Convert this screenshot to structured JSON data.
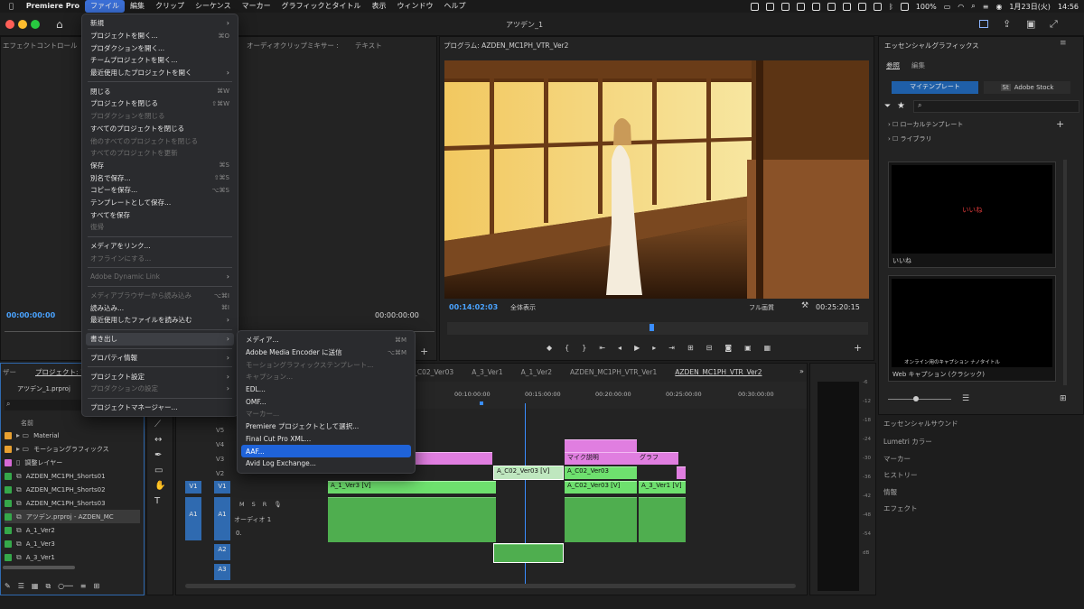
{
  "menubar": {
    "items": [
      "Premiere Pro",
      "ファイル",
      "編集",
      "クリップ",
      "シーケンス",
      "マーカー",
      "グラフィックとタイトル",
      "表示",
      "ウィンドウ",
      "ヘルプ"
    ],
    "battery": "100%",
    "wifi": "",
    "date": "1月23日(火)",
    "time": "14:56"
  },
  "window": {
    "title": "アツデン_1"
  },
  "file_menu": [
    {
      "label": "新規",
      "shortcut": "",
      "submenu": true,
      "disabled": false
    },
    {
      "label": "プロジェクトを開く...",
      "shortcut": "⌘O",
      "submenu": false,
      "disabled": false
    },
    {
      "label": "プロダクションを開く...",
      "shortcut": "",
      "submenu": false,
      "disabled": false
    },
    {
      "label": "チームプロジェクトを開く...",
      "shortcut": "",
      "submenu": false,
      "disabled": false
    },
    {
      "label": "最近使用したプロジェクトを開く",
      "shortcut": "",
      "submenu": true,
      "disabled": false
    },
    {
      "sep": true
    },
    {
      "label": "閉じる",
      "shortcut": "⌘W",
      "submenu": false,
      "disabled": false
    },
    {
      "label": "プロジェクトを閉じる",
      "shortcut": "⇧⌘W",
      "submenu": false,
      "disabled": false
    },
    {
      "label": "プロダクションを閉じる",
      "shortcut": "",
      "submenu": false,
      "disabled": true
    },
    {
      "label": "すべてのプロジェクトを閉じる",
      "shortcut": "",
      "submenu": false,
      "disabled": false
    },
    {
      "label": "他のすべてのプロジェクトを閉じる",
      "shortcut": "",
      "submenu": false,
      "disabled": true
    },
    {
      "label": "すべてのプロジェクトを更新",
      "shortcut": "",
      "submenu": false,
      "disabled": true
    },
    {
      "label": "保存",
      "shortcut": "⌘S",
      "submenu": false,
      "disabled": false
    },
    {
      "label": "別名で保存...",
      "shortcut": "⇧⌘S",
      "submenu": false,
      "disabled": false
    },
    {
      "label": "コピーを保存...",
      "shortcut": "⌥⌘S",
      "submenu": false,
      "disabled": false
    },
    {
      "label": "テンプレートとして保存...",
      "shortcut": "",
      "submenu": false,
      "disabled": false
    },
    {
      "label": "すべてを保存",
      "shortcut": "",
      "submenu": false,
      "disabled": false
    },
    {
      "label": "復帰",
      "shortcut": "",
      "submenu": false,
      "disabled": true
    },
    {
      "sep": true
    },
    {
      "label": "メディアをリンク...",
      "shortcut": "",
      "submenu": false,
      "disabled": false
    },
    {
      "label": "オフラインにする...",
      "shortcut": "",
      "submenu": false,
      "disabled": true
    },
    {
      "sep": true
    },
    {
      "label": "Adobe Dynamic Link",
      "shortcut": "",
      "submenu": true,
      "disabled": true
    },
    {
      "sep": true
    },
    {
      "label": "メディアブラウザーから読み込み",
      "shortcut": "⌥⌘I",
      "submenu": false,
      "disabled": true
    },
    {
      "label": "読み込み...",
      "shortcut": "⌘I",
      "submenu": false,
      "disabled": false
    },
    {
      "label": "最近使用したファイルを読み込む",
      "shortcut": "",
      "submenu": true,
      "disabled": false
    },
    {
      "sep": true
    },
    {
      "label": "書き出し",
      "shortcut": "",
      "submenu": true,
      "disabled": false,
      "highlight": true
    },
    {
      "sep": true
    },
    {
      "label": "プロパティ情報",
      "shortcut": "",
      "submenu": true,
      "disabled": false
    },
    {
      "sep": true
    },
    {
      "label": "プロジェクト設定",
      "shortcut": "",
      "submenu": true,
      "disabled": false
    },
    {
      "label": "プロダクションの設定",
      "shortcut": "",
      "submenu": true,
      "disabled": true
    },
    {
      "sep": true
    },
    {
      "label": "プロジェクトマネージャー...",
      "shortcut": "",
      "submenu": false,
      "disabled": false
    }
  ],
  "export_menu": [
    {
      "label": "メディア...",
      "shortcut": "⌘M",
      "disabled": false
    },
    {
      "label": "Adobe Media Encoder に送信",
      "shortcut": "⌥⌘M",
      "disabled": false
    },
    {
      "label": "モーショングラフィックステンプレート...",
      "shortcut": "",
      "disabled": true
    },
    {
      "label": "キャプション...",
      "shortcut": "",
      "disabled": true
    },
    {
      "label": "EDL...",
      "shortcut": "",
      "disabled": false
    },
    {
      "label": "OMF...",
      "shortcut": "",
      "disabled": false
    },
    {
      "label": "マーカー...",
      "shortcut": "",
      "disabled": true
    },
    {
      "label": "Premiere プロジェクトとして選択...",
      "shortcut": "",
      "disabled": false
    },
    {
      "label": "Final Cut Pro XML...",
      "shortcut": "",
      "disabled": false
    },
    {
      "label": "AAF...",
      "shortcut": "",
      "disabled": false,
      "selected": true
    },
    {
      "label": "Avid Log Exchange...",
      "shortcut": "",
      "disabled": false
    }
  ],
  "source_panel": {
    "tab_effect": "エフェクトコントロール",
    "tab_audio": "オーディオクリップミキサー :",
    "tab_text": "テキスト",
    "tc_left": "00:00:00:00",
    "tc_right": "00:00:00:00"
  },
  "program": {
    "title": "プログラム: AZDEN_MC1PH_VTR_Ver2",
    "tc_current": "00:14:02:03",
    "fit": "全体表示",
    "quality": "フル画質",
    "tc_duration": "00:25:20:15"
  },
  "project": {
    "tab0": "ザー",
    "tab": "プロジェクト: ア",
    "file": "アツデン_1.prproj",
    "col_name": "名前",
    "items": [
      {
        "name": "Material",
        "color": "#e8a030",
        "type": "folder"
      },
      {
        "name": "モーショングラフィックス",
        "color": "#e8a030",
        "type": "folder"
      },
      {
        "name": "調整レイヤー",
        "color": "#d66ad6",
        "type": "layer"
      },
      {
        "name": "AZDEN_MC1PH_Shorts01",
        "color": "#35a84a",
        "type": "seq"
      },
      {
        "name": "AZDEN_MC1PH_Shorts02",
        "color": "#35a84a",
        "type": "seq"
      },
      {
        "name": "AZDEN_MC1PH_Shorts03",
        "color": "#35a84a",
        "type": "seq"
      },
      {
        "name": "アツデン.prproj - AZDEN_MC",
        "color": "#35a84a",
        "type": "proj"
      },
      {
        "name": "A_1_Ver2",
        "color": "#35a84a",
        "type": "seq"
      },
      {
        "name": "A_1_Ver3",
        "color": "#35a84a",
        "type": "seq"
      },
      {
        "name": "A_3_Ver1",
        "color": "#35a84a",
        "type": "seq"
      }
    ]
  },
  "timeline": {
    "tabs": [
      "A_C02_Ver03",
      "A_3_Ver1",
      "A_1_Ver2",
      "AZDEN_MC1PH_VTR_Ver1",
      "AZDEN_MC1PH_VTR_Ver2"
    ],
    "ruler": [
      "00:10:00:00",
      "00:15:00:00",
      "00:20:00:00",
      "00:25:00:00",
      "00:30:00:00"
    ],
    "tracks_v": [
      "V5",
      "V4",
      "V3",
      "V2",
      "V1"
    ],
    "tracks_a": [
      "A1",
      "A2",
      "A3"
    ],
    "src_v1": "V1",
    "src_a1": "A1",
    "audio_label": "オーディオ 1",
    "audio_value": "0.",
    "clips": {
      "c1": "A_C02_Ver03 [V]",
      "c2": "A_C02_Ver03",
      "c3": "マイク説明",
      "c4": "グラフ",
      "c5": "A_1_Ver3 [V]",
      "c6": "A_C02_Ver03 [V]",
      "c7": "A_3_Ver1 [V]"
    },
    "meter": [
      "-6",
      "-12",
      "-18",
      "-24",
      "-30",
      "-36",
      "-42",
      "-48",
      "-54",
      "dB"
    ]
  },
  "essential": {
    "title": "エッセンシャルグラフィックス",
    "tab_browse": "参照",
    "tab_edit": "編集",
    "btn_my": "マイテンプレート",
    "btn_stock": "Adobe Stock",
    "local": "ローカルテンプレート",
    "library": "ライブラリ",
    "tpl1_text": "いいね",
    "tpl1_name": "いいね",
    "tpl2_text": "オンライン用のキャプション ナノタイトル",
    "tpl2_name": "Web キャプション (クラシック)"
  },
  "right_list": [
    "エッセンシャルサウンド",
    "Lumetri カラー",
    "マーカー",
    "ヒストリー",
    "情報",
    "エフェクト"
  ]
}
